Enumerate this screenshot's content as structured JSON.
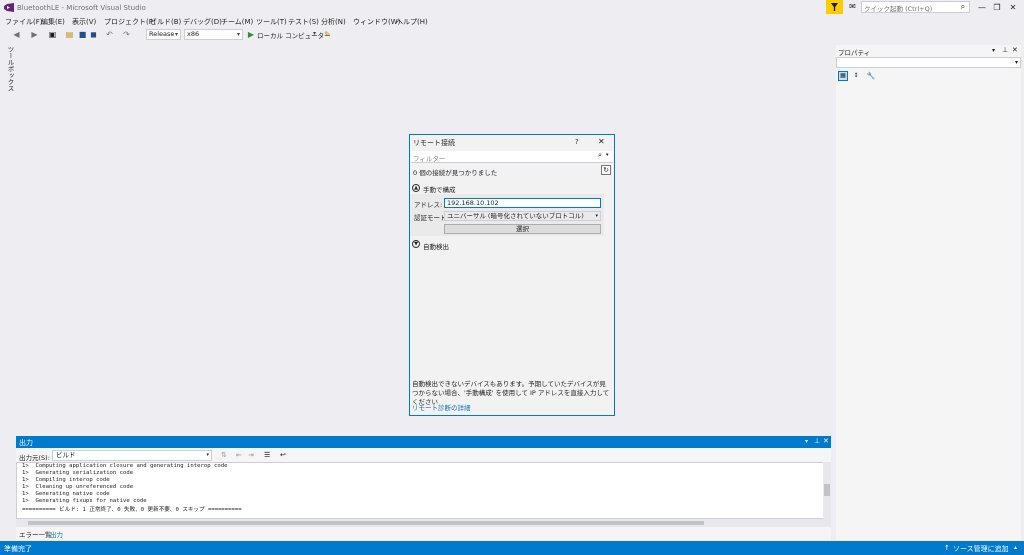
{
  "window": {
    "title": "BluetoothLE - Microsoft Visual Studio",
    "quick_launch_placeholder": "クイック起動 (Ctrl+Q)"
  },
  "menu": [
    "ファイル(F)",
    "編集(E)",
    "表示(V)",
    "プロジェクト(P)",
    "ビルド(B)",
    "デバッグ(D)",
    "チーム(M)",
    "ツール(T)",
    "テスト(S)",
    "分析(N)",
    "ウィンドウ(W)",
    "ヘルプ(H)"
  ],
  "toolbar": {
    "config": "Release",
    "platform": "x86",
    "run_label": "ローカル コンピューター"
  },
  "toolbox_tab": "ツールボックス",
  "properties": {
    "title": "プロパティ"
  },
  "dialog": {
    "title": "リモート接続",
    "help": "?",
    "filter_placeholder": "フィルター",
    "count_text": "0 個の接続が見つかりました",
    "manual_section": "手動で構成",
    "address_label": "アドレス:",
    "address_value": "192.168.10.102",
    "auth_label": "認証モード:",
    "auth_value": "ユニバーサル (暗号化されていないプロトコル)",
    "select_button": "選択",
    "auto_section": "自動検出",
    "note": "自動検出できないデバイスもあります。予期していたデバイスが見つからない場合、'手動構成' を使用して IP アドレスを直接入力してください",
    "link": "リモート診断の詳細"
  },
  "output": {
    "title": "出力",
    "source_label": "出力元(S):",
    "source_value": "ビルド",
    "lines": [
      "1>  Computing application closure and generating interop code",
      "1>  Generating serialization code",
      "1>  Compiling interop code",
      "1>  Cleaning up unreferenced code",
      "1>  Generating native code",
      "1>  Generating fixups for native code",
      "========== ビルド: 1 正常終了、0 失敗、0 更新不要、0 スキップ =========="
    ]
  },
  "bottom_tabs": [
    "エラー一覧",
    "出力"
  ],
  "status": {
    "left": "準備完了",
    "right": "ソース管理に追加"
  },
  "colors": {
    "accent": "#007acc",
    "filter": "#ffcc00",
    "link": "#0e70c0"
  }
}
